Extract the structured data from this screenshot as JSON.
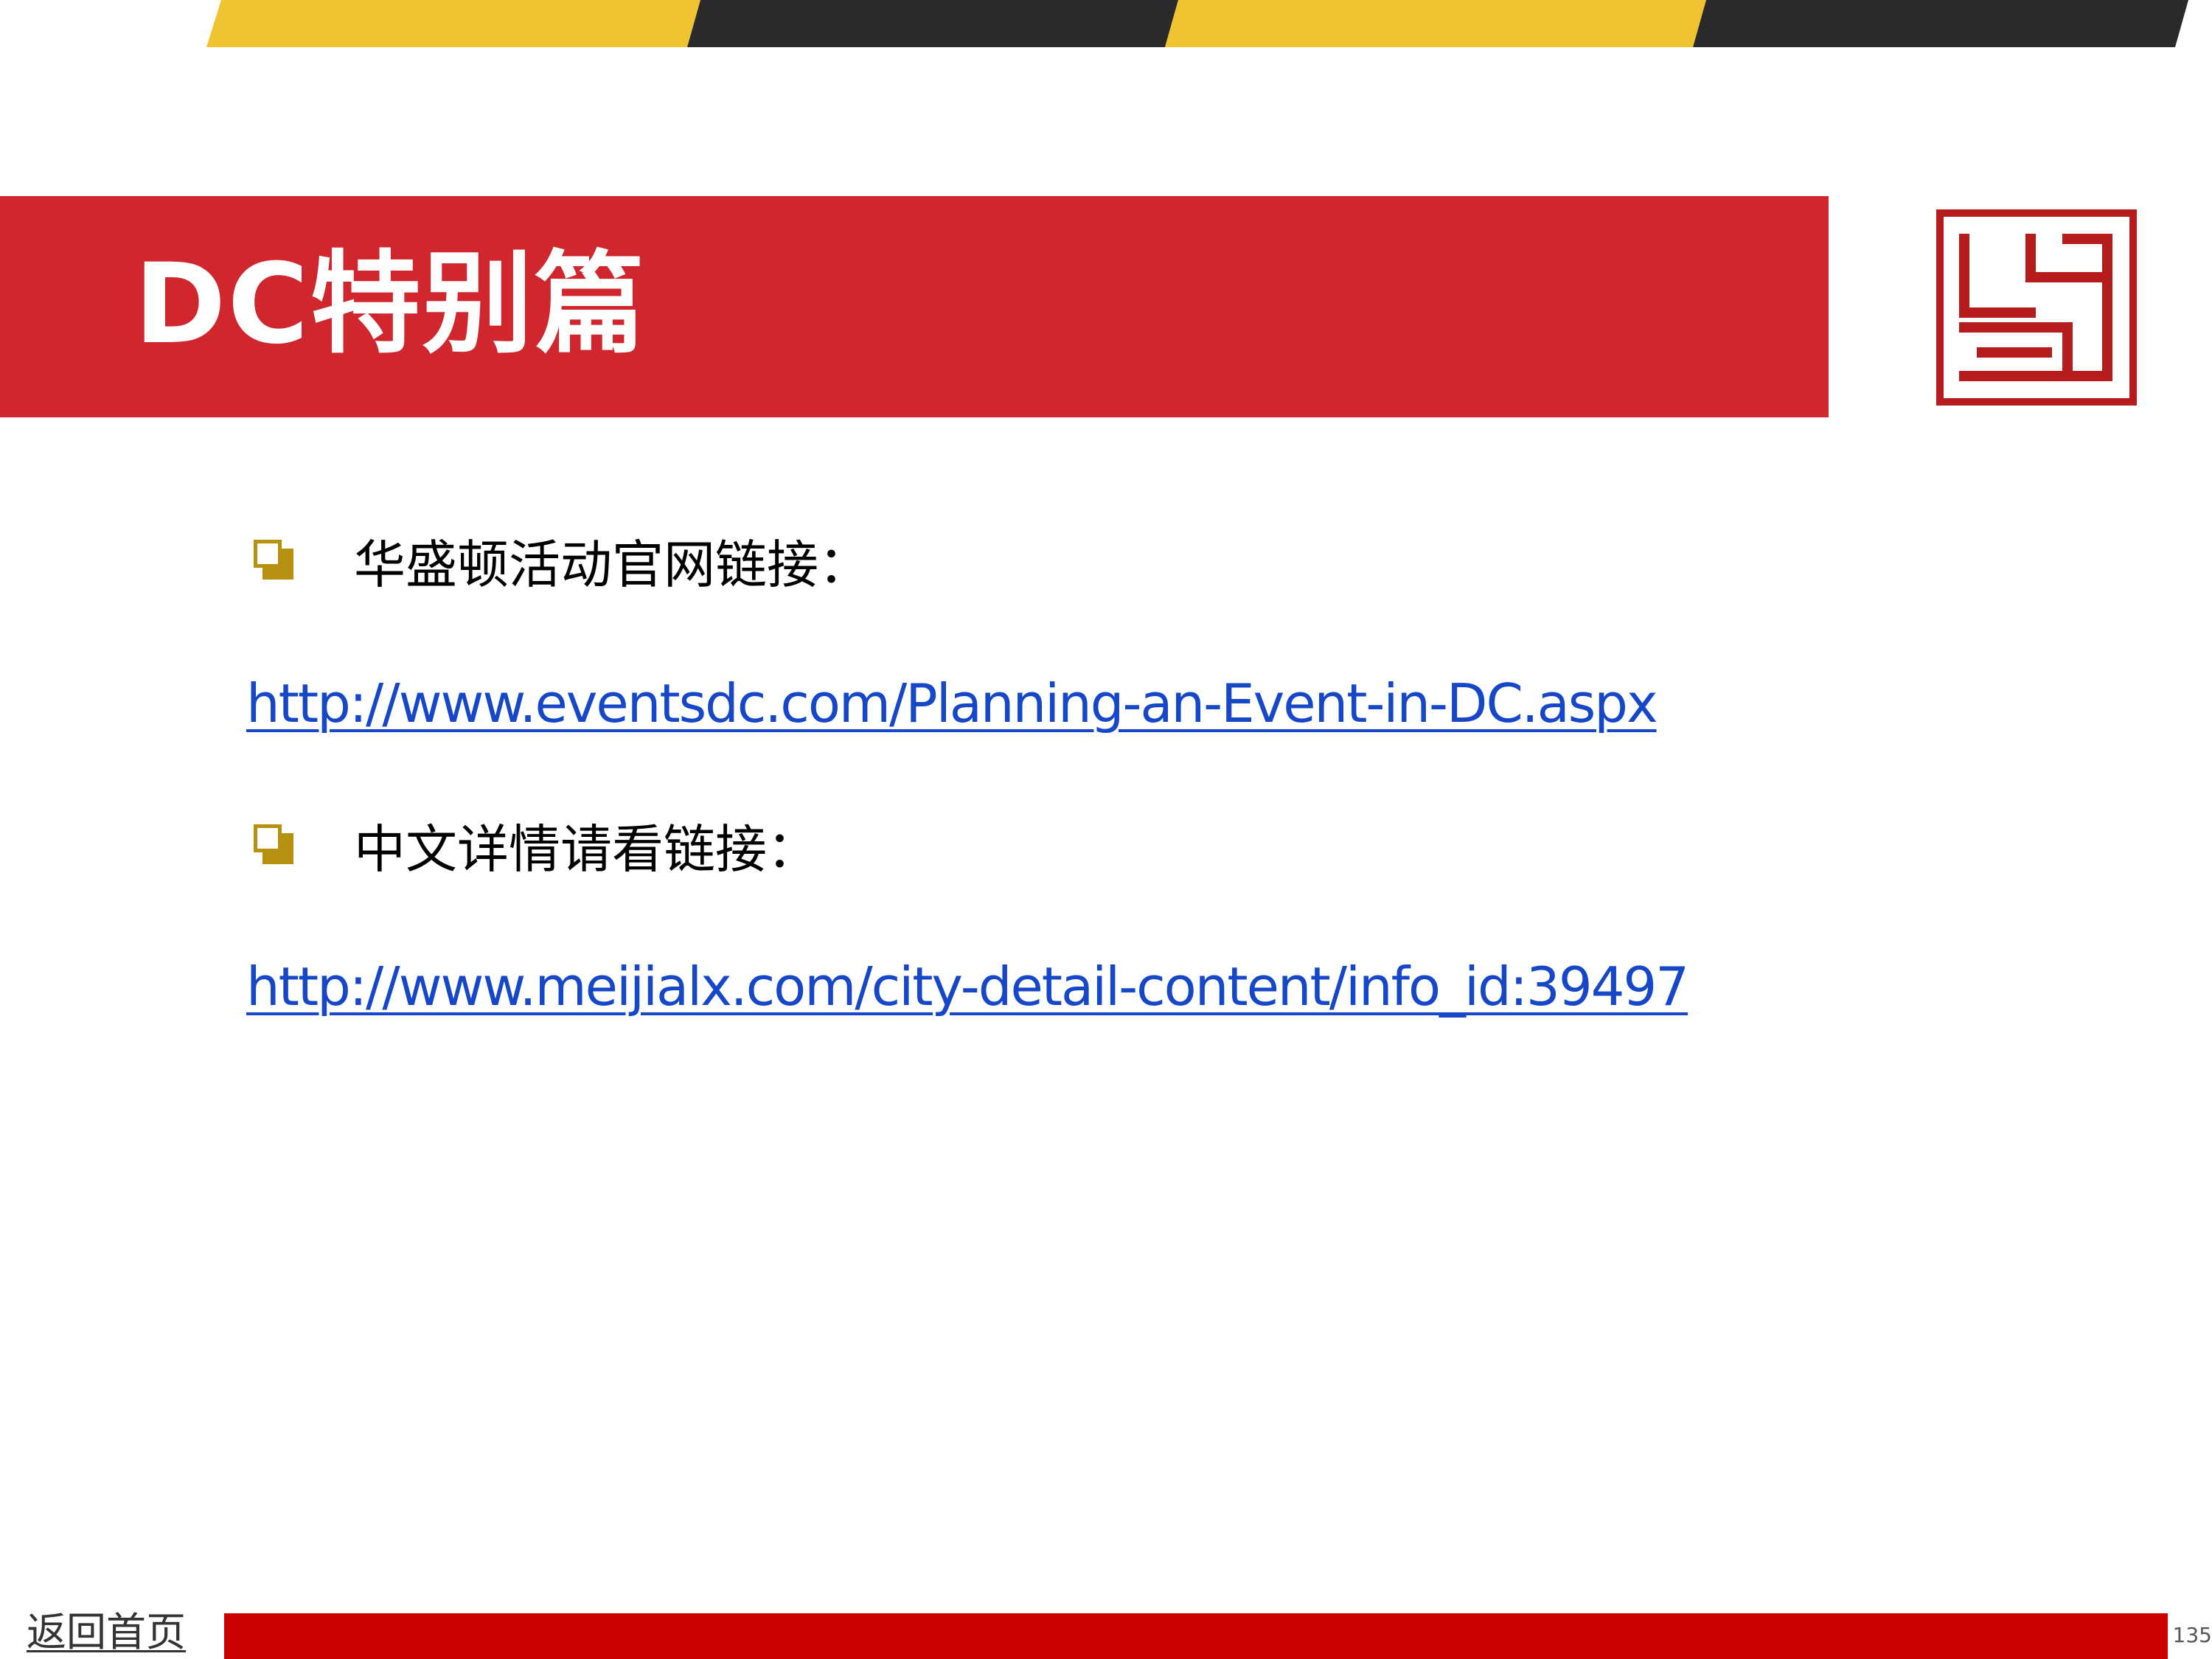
{
  "header": {
    "title": "DC特别篇"
  },
  "content": {
    "items": [
      {
        "label": "华盛顿活动官网链接：",
        "link": "http://www.eventsdc.com/Planning-an-Event-in-DC.aspx"
      },
      {
        "label": "中文详情请看链接：",
        "link": "http://www.meijialx.com/city-detail-content/info_id:39497"
      }
    ]
  },
  "footer": {
    "home_link": "返回首页",
    "page_number": "135"
  },
  "colors": {
    "title_banner": "#d0272e",
    "stripe_yellow": "#f0c330",
    "stripe_dark": "#2a2a2a",
    "bullet_gold": "#b8900f",
    "link_blue": "#1547c8",
    "footer_bar": "#cc0000",
    "seal": "#b71c1c"
  },
  "icons": {
    "bullet": "square-bullet-icon",
    "logo": "seal-logo-icon"
  }
}
